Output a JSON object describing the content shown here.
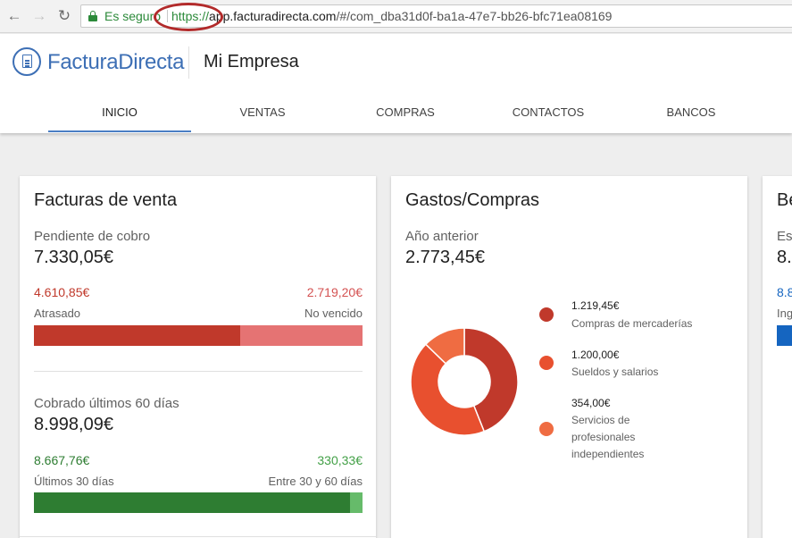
{
  "browser": {
    "secure_label": "Es seguro",
    "url_scheme": "https://",
    "url_host": "app.facturadirecta.com",
    "url_path": "/#/com_dba31d0f-ba1a-47e7-bb26-bfc71ea08169"
  },
  "header": {
    "brand": "FacturaDirecta",
    "company": "Mi Empresa",
    "tabs": [
      {
        "label": "INICIO",
        "active": true
      },
      {
        "label": "VENTAS"
      },
      {
        "label": "COMPRAS"
      },
      {
        "label": "CONTACTOS"
      },
      {
        "label": "BANCOS"
      }
    ]
  },
  "sales_card": {
    "title": "Facturas de venta",
    "pending": {
      "label": "Pendiente de cobro",
      "amount": "7.330,05€",
      "overdue_amount": "4.610,85€",
      "overdue_label": "Atrasado",
      "notdue_amount": "2.719,20€",
      "notdue_label": "No vencido",
      "overdue_fraction": 0.629,
      "overdue_color": "#c0392b",
      "notdue_color": "#e57373"
    },
    "collected": {
      "label": "Cobrado últimos 60 días",
      "amount": "8.998,09€",
      "last30_amount": "8.667,76€",
      "last30_label": "Últimos 30 días",
      "between_amount": "330,33€",
      "between_label": "Entre 30 y 60 días",
      "last30_fraction": 0.963,
      "last30_color": "#2e7d32",
      "between_color": "#66bb6a"
    }
  },
  "expenses_card": {
    "title": "Gastos/Compras",
    "period_label": "Año anterior",
    "amount": "2.773,45€",
    "legend": [
      {
        "amount": "1.219,45€",
        "label": "Compras de mercaderías",
        "value": 1219.45,
        "color": "#c0392b"
      },
      {
        "amount": "1.200,00€",
        "label": "Sueldos y salarios",
        "value": 1200.0,
        "color": "#e8502f"
      },
      {
        "amount": "354,00€",
        "label": "Servicios de profesionales independientes",
        "value": 354.0,
        "color": "#ef6c42"
      }
    ]
  },
  "third_card": {
    "title_fragment": "Be",
    "sub_fragment": "Es",
    "amount_fragment": "8.",
    "small_fragment": "8.8",
    "label_fragment": "Ing",
    "bar_color": "#1565c0"
  }
}
